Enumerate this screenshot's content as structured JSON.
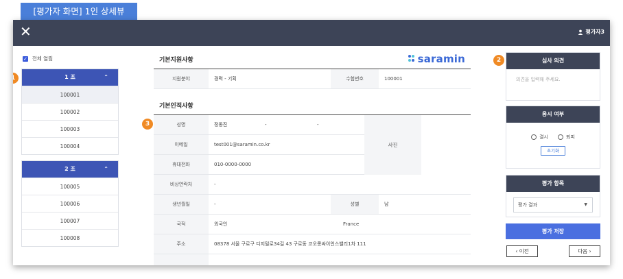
{
  "caption": "[평가자 화면] 1인 상세뷰",
  "header": {
    "close_glyph": "✕",
    "user_name": "평가자3"
  },
  "left": {
    "select_all_label": "전체 열림",
    "groups": [
      {
        "label": "1 조",
        "items": [
          "100001",
          "100002",
          "100003",
          "100004"
        ]
      },
      {
        "label": "2 조",
        "items": [
          "100005",
          "100006",
          "100007",
          "100008"
        ]
      }
    ]
  },
  "badges": [
    "1",
    "2",
    "3"
  ],
  "basic_apply": {
    "title": "기본지원사항",
    "field_label": "지원분야",
    "field_value": "경력 - 기획",
    "exam_label": "수험번호",
    "exam_value": "100001"
  },
  "logo": {
    "text": "saramin"
  },
  "personal": {
    "title": "기본인적사항",
    "name_label": "성명",
    "name_value": "정동진",
    "name_dash1": "-",
    "name_dash2": "-",
    "email_label": "이메일",
    "email_value": "test001@saramin.co.kr",
    "phone_label": "휴대전화",
    "phone_value": "010-0000-0000",
    "emergency_label": "비상연락처",
    "emergency_value": "-",
    "birth_label": "생년월일",
    "birth_value": "-",
    "gender_label": "성별",
    "gender_value": "남",
    "nationality_label": "국적",
    "nationality_value": "외국인",
    "nationality_country": "France",
    "address_label": "주소",
    "address_value": "08378 서울 구로구 디지털로34길 43 구로동 코오롱싸이언스밸리1차 111",
    "photo_label": "사진"
  },
  "review": {
    "title": "심사 의견",
    "placeholder": "의견을 입력해 주세요."
  },
  "attend": {
    "title": "응시 여부",
    "absent": "결시",
    "withdraw": "퇴피",
    "reset": "초기화"
  },
  "evaluate": {
    "title": "평가 항목",
    "select_value": "평가 결과"
  },
  "save_label": "평가 저장",
  "prev_label": "‹  이전",
  "next_label": "다음  ›",
  "colors": {
    "accent": "#3d55b5",
    "topbar": "#3d4457",
    "badge": "#f08a24",
    "caption": "#4a7fd9"
  }
}
